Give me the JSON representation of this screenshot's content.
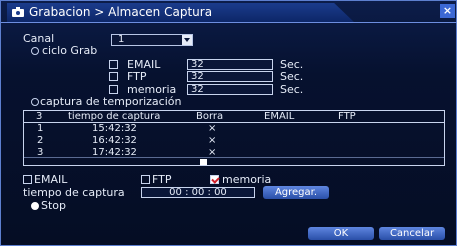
{
  "window": {
    "title": "Grabacion > Almacen Captura",
    "close_icon": "×"
  },
  "canal": {
    "label": "Canal",
    "value": "1"
  },
  "ciclo": {
    "label": "ciclo Grab",
    "email": {
      "label": "EMAIL",
      "value": "32",
      "unit": "Sec."
    },
    "ftp": {
      "label": "FTP",
      "value": "32",
      "unit": "Sec."
    },
    "memoria": {
      "label": "memoria",
      "value": "32",
      "unit": "Sec."
    }
  },
  "temporizacion": {
    "label": "captura de temporización",
    "table": {
      "headers": [
        "3",
        "tiempo de captura",
        "Borra",
        "EMAIL",
        "FTP"
      ],
      "rows": [
        {
          "n": "1",
          "time": "15:42:32",
          "del": "×"
        },
        {
          "n": "2",
          "time": "16:42:32",
          "del": "×"
        },
        {
          "n": "3",
          "time": "17:42:32",
          "del": "×"
        }
      ]
    },
    "email_label": "EMAIL",
    "ftp_label": "FTP",
    "memoria_label": "memoria",
    "tiempo_label": "tiempo de captura",
    "tiempo_value": "00 : 00 : 00",
    "agregar_label": "Agregar."
  },
  "stop_label": "Stop",
  "buttons": {
    "ok": "OK",
    "cancel": "Cancelar"
  }
}
